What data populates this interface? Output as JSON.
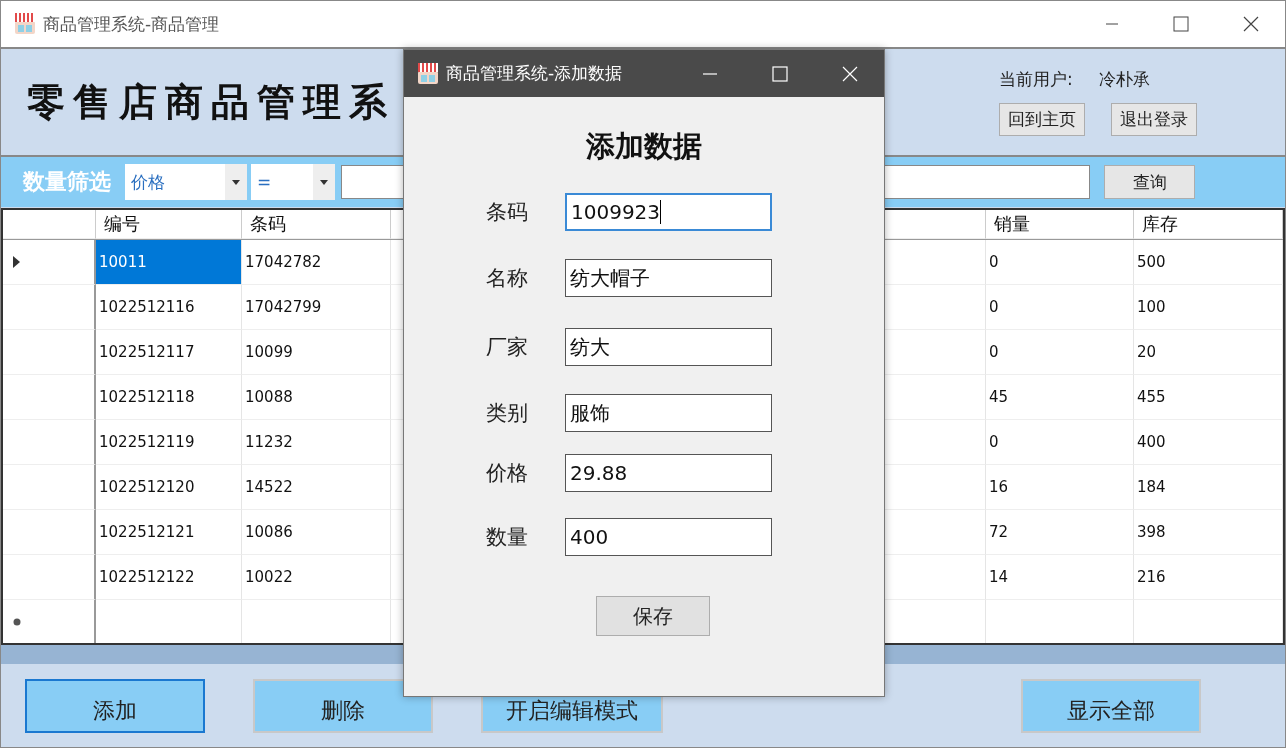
{
  "window": {
    "title": "商品管理系统-商品管理"
  },
  "header": {
    "title": "零售店商品管理系",
    "user_label": "当前用户:",
    "user_name": "冷朴承",
    "buttons": [
      "回到主页",
      "退出登录"
    ]
  },
  "filter": {
    "label": "数量筛选",
    "field_select": "价格",
    "operator_select": "=",
    "query_button": "查询"
  },
  "table": {
    "columns": [
      "编号",
      "条码",
      "销量",
      "库存"
    ],
    "rows": [
      {
        "cells": [
          "10011",
          "17042782",
          "0",
          "500"
        ],
        "current": true,
        "selected": true
      },
      {
        "cells": [
          "1022512116",
          "17042799",
          "0",
          "100"
        ],
        "current": false,
        "selected": false
      },
      {
        "cells": [
          "1022512117",
          "10099",
          "0",
          "20"
        ],
        "current": false,
        "selected": false
      },
      {
        "cells": [
          "1022512118",
          "10088",
          "45",
          "455"
        ],
        "current": false,
        "selected": false
      },
      {
        "cells": [
          "1022512119",
          "11232",
          "0",
          "400"
        ],
        "current": false,
        "selected": false
      },
      {
        "cells": [
          "1022512120",
          "14522",
          "16",
          "184"
        ],
        "current": false,
        "selected": false
      },
      {
        "cells": [
          "1022512121",
          "10086",
          "72",
          "398"
        ],
        "current": false,
        "selected": false
      },
      {
        "cells": [
          "1022512122",
          "10022",
          "14",
          "216"
        ],
        "current": false,
        "selected": false
      }
    ]
  },
  "bottom_buttons": [
    {
      "label": "添加",
      "focused": true
    },
    {
      "label": "删除",
      "focused": false
    },
    {
      "label": "开启编辑模式",
      "focused": false
    },
    {
      "label": "显示全部",
      "focused": false
    }
  ],
  "dialog": {
    "title": "商品管理系统-添加数据",
    "heading": "添加数据",
    "fields": [
      {
        "label": "条码",
        "value": "1009923",
        "focused": true
      },
      {
        "label": "名称",
        "value": "纺大帽子",
        "focused": false
      },
      {
        "label": "厂家",
        "value": "纺大",
        "focused": false
      },
      {
        "label": "类别",
        "value": "服饰",
        "focused": false
      },
      {
        "label": "价格",
        "value": "29.88",
        "focused": false
      },
      {
        "label": "数量",
        "value": "400",
        "focused": false
      }
    ],
    "save_button": "保存"
  }
}
